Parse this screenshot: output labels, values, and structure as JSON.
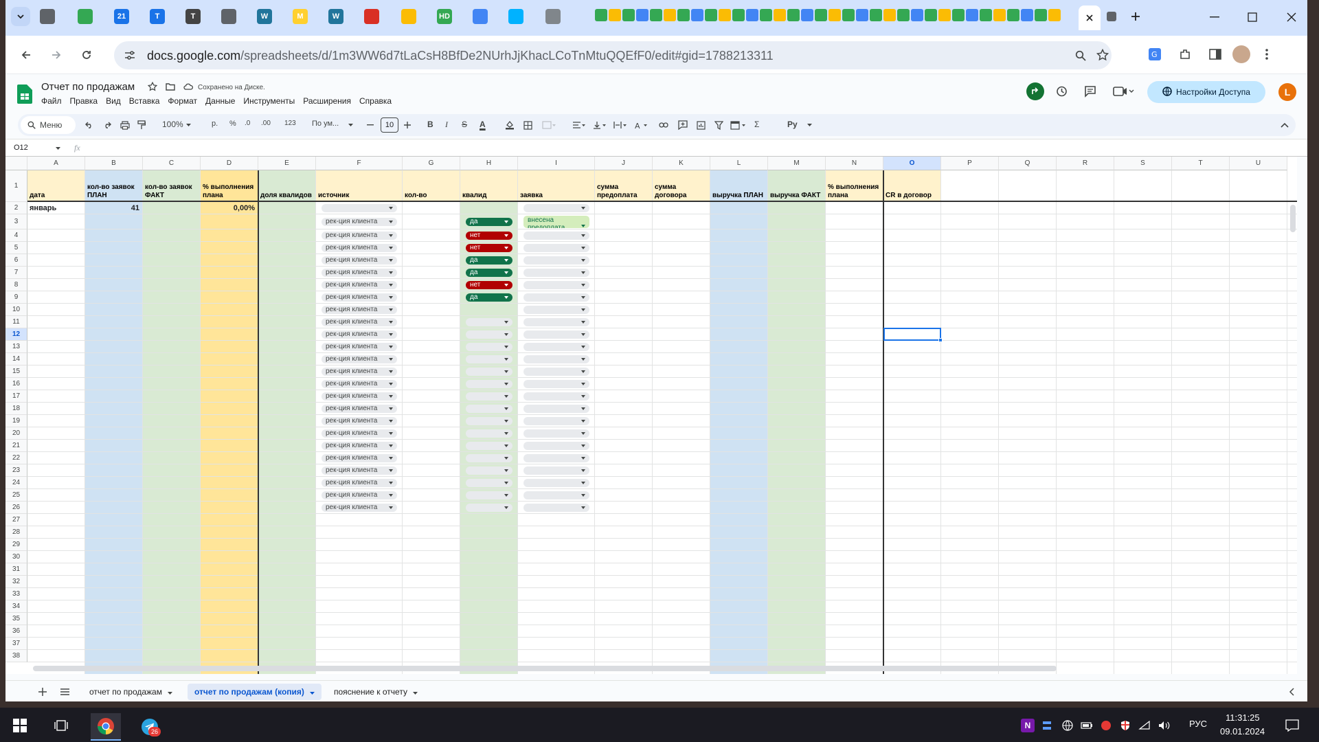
{
  "browser": {
    "url_host": "docs.google.com",
    "url_path": "/spreadsheets/d/1m3WW6d7tLaCsH8BfDe2NUrhJjKhacLCoTnMtuQQEfF0/edit#gid=1788213311",
    "tab_icons": [
      {
        "name": "tab-list-icon",
        "color": "#5f6368"
      },
      {
        "name": "green-circle-icon",
        "color": "#34a853"
      },
      {
        "name": "calendar-21-icon",
        "color": "#1a73e8",
        "text": "21"
      },
      {
        "name": "teletype-icon",
        "color": "#1a73e8",
        "text": "T"
      },
      {
        "name": "t-circle-icon",
        "color": "#444",
        "text": "T"
      },
      {
        "name": "globe-icon",
        "color": "#5f6368"
      },
      {
        "name": "wordpress-icon",
        "color": "#21759b",
        "text": "W"
      },
      {
        "name": "miro-icon",
        "color": "#ffd02f",
        "text": "M"
      },
      {
        "name": "wordpress-icon-2",
        "color": "#21759b",
        "text": "W"
      },
      {
        "name": "red-circle-icon",
        "color": "#d93025"
      },
      {
        "name": "yellow-bolt-icon",
        "color": "#fbbc04"
      },
      {
        "name": "hd-icon",
        "color": "#34a853",
        "text": "HD"
      },
      {
        "name": "multicolor-icon",
        "color": "#4285f4"
      },
      {
        "name": "play-icon",
        "color": "#00b2ff"
      },
      {
        "name": "printer-icon",
        "color": "#80868b"
      }
    ],
    "pinned_count": 34
  },
  "app": {
    "title": "Отчет по продажам",
    "saved": "Сохранено на Диске.",
    "menu": [
      "Файл",
      "Правка",
      "Вид",
      "Вставка",
      "Формат",
      "Данные",
      "Инструменты",
      "Расширения",
      "Справка"
    ],
    "share_label": "Настройки Доступа",
    "avatar_letter": "L",
    "toolbar": {
      "menu_search": "Меню",
      "zoom": "100%",
      "currency": "р.",
      "percent": "%",
      "dec_less": ".0",
      "dec_more": ".00",
      "num_format": "123",
      "font": "По ум...",
      "font_size": "10",
      "bold": "B",
      "italic": "I",
      "strike": "S",
      "textcolor": "A",
      "sigma": "Σ",
      "ru": "Ру"
    },
    "cell_ref": "O12",
    "fx": "fx"
  },
  "sheet": {
    "columns": [
      "A",
      "B",
      "C",
      "D",
      "E",
      "F",
      "G",
      "H",
      "I",
      "J",
      "K",
      "L",
      "M",
      "N",
      "O",
      "P",
      "Q",
      "R",
      "S",
      "T",
      "U"
    ],
    "headers": {
      "A": "дата",
      "B": "кол-во заявок ПЛАН",
      "C": "кол-во заявок ФАКТ",
      "D": "% выполнения плана",
      "E": "доля квалидов",
      "F": "источник",
      "G": "кол-во",
      "H": "квалид",
      "I": "заявка",
      "J": "сумма предоплата",
      "K": "сумма договора",
      "L": "выручка ПЛАН",
      "M": "выручка ФАКТ",
      "N": "% выполнения плана",
      "O": "CR в договор"
    },
    "row2": {
      "A": "январь",
      "B": "41",
      "D": "0,00%"
    },
    "source_chip": "рек-ция клиента",
    "i3_chip": "внесена предоплата",
    "h_values": [
      "да",
      "нет",
      "нет",
      "да",
      "да",
      "нет",
      "да"
    ],
    "row_numbers": [
      "1",
      "2",
      "3",
      "4",
      "5",
      "6",
      "7",
      "8",
      "9",
      "10",
      "11",
      "12",
      "13",
      "14",
      "15",
      "16",
      "17",
      "18",
      "19",
      "20",
      "21",
      "22",
      "23",
      "24",
      "25",
      "26",
      "27",
      "28",
      "29",
      "30",
      "31",
      "32",
      "33",
      "34",
      "35",
      "36",
      "37",
      "38"
    ],
    "selected_cell": "O12"
  },
  "sheet_tabs": [
    "отчет по продажам",
    "отчет по продажам (копия)",
    "пояснение к отчету"
  ],
  "active_sheet_tab": 1,
  "taskbar": {
    "time": "11:31:25",
    "date": "09.01.2024",
    "lang": "РУС",
    "telegram_badge": "26"
  }
}
